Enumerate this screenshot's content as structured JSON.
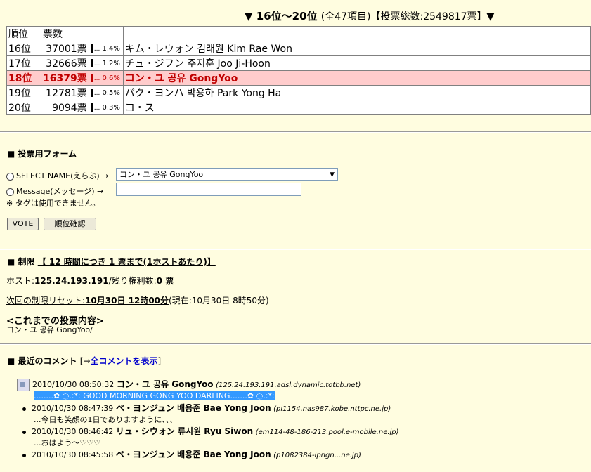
{
  "ranking": {
    "title_main": "▼ 16位〜20位",
    "title_sub": "(全47項目)【投票総数:2549817票】▼",
    "headers": [
      "順位",
      "票数",
      "",
      ""
    ],
    "rows": [
      {
        "rank": "16位",
        "votes": "37001票",
        "dots": "...",
        "pct": "1.4%",
        "name": "キム・レウォン 김래원 Kim Rae Won"
      },
      {
        "rank": "17位",
        "votes": "32666票",
        "dots": "...",
        "pct": "1.2%",
        "name": "チュ・ジフン  주지훈  Joo Ji-Hoon"
      },
      {
        "rank": "18位",
        "votes": "16379票",
        "dots": "...",
        "pct": "0.6%",
        "name": "コン・ユ  공유  GongYoo"
      },
      {
        "rank": "19位",
        "votes": "12781票",
        "dots": "...",
        "pct": "0.5%",
        "name": "パク・ヨンハ  박용하  Park Yong Ha"
      },
      {
        "rank": "20位",
        "votes": "9094票",
        "dots": "...",
        "pct": "0.3%",
        "name": "コ・ス"
      }
    ],
    "highlight_color": "#ffcccc"
  },
  "form": {
    "heading": "■ 投票用フォーム",
    "select_label": "SELECT NAME(えらぶ) →",
    "select_value": "コン・ユ  공유  GongYoo",
    "message_label": "Message(メッセージ) →",
    "message_value": "",
    "note": "※ タグは使用できません。",
    "vote_button": "VOTE",
    "rank_button": "順位確認"
  },
  "limit": {
    "heading_prefix": "■ 制限",
    "heading_rule": "【 12 時間につき 1 票まで(1ホストあたり)】",
    "host_label": "ホスト:",
    "host_value": "125.24.193.191",
    "remaining_label": "/残り権利数:",
    "remaining_value": "0 票",
    "reset_label": "次回の制限リセット:",
    "reset_value": "10月30日 12時00分",
    "current_time": "(現在:10月30日 8時50分)",
    "history_heading": "<これまでの投票内容>",
    "history_value": "コン・ユ 공유 GongYoo/"
  },
  "comments": {
    "heading": "■ 最近のコメント",
    "bracket_open": "[→",
    "show_all_link": "全コメントを表示",
    "bracket_close": "]",
    "items": [
      {
        "time": "2010/10/30 08:50:32",
        "name": "コン・ユ  공유  GongYoo",
        "host": "(125.24.193.191.adsl.dynamic.totbb.net)",
        "message": "........✿ ◌.:*: GOOD MORNING GONG YOO DARLING.......✿ ◌.:*:"
      },
      {
        "time": "2010/10/30 08:47:39",
        "name": "ペ・ヨンジュン  배용준  Bae Yong Joon",
        "host": "(pl1154.nas987.kobe.nttpc.ne.jp)",
        "message": "...今日も笑顔の1日でありますように、、、"
      },
      {
        "time": "2010/10/30 08:46:42",
        "name": "リュ・シウォン  류시원  Ryu Siwon",
        "host": "(em114-48-186-213.pool.e-mobile.ne.jp)",
        "message": "...おはよう〜♡♡♡"
      },
      {
        "time": "2010/10/30 08:45:58",
        "name": "ペ・ヨンジュン  배용준  Bae Yong Joon",
        "host": "(p1082384-ipngn...ne.jp)",
        "message": ""
      }
    ]
  }
}
